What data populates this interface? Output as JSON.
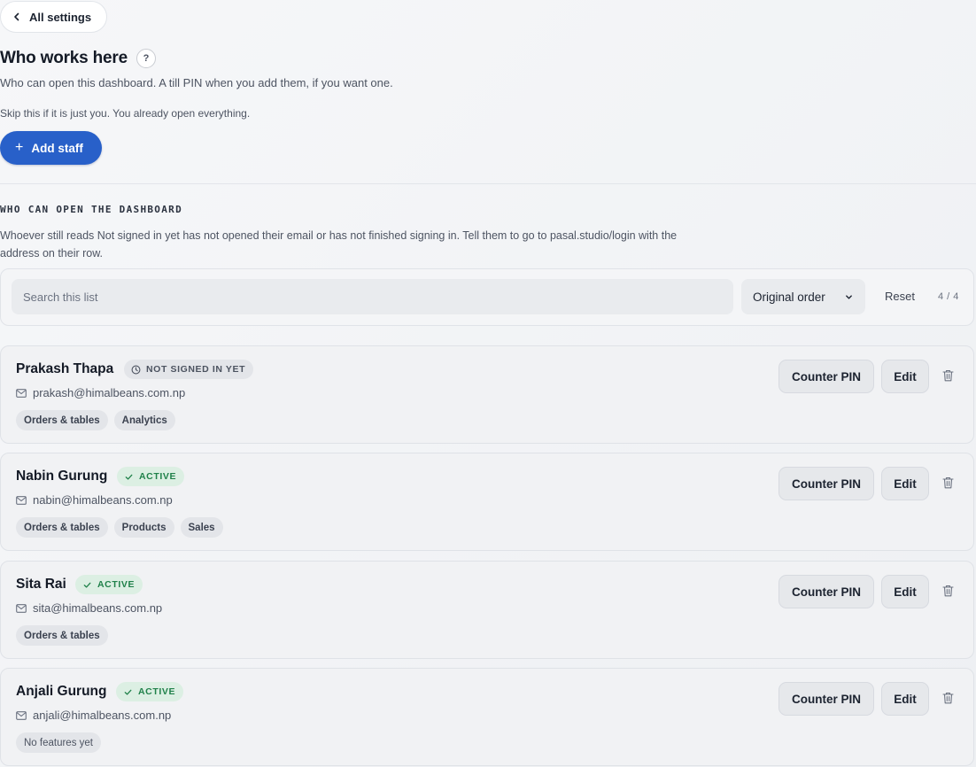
{
  "header": {
    "back_label": "All settings",
    "title": "Who works here",
    "help_glyph": "?",
    "subtitle": "Who can open this dashboard. A till PIN when you add them, if you want one.",
    "hint": "Skip this if it is just you. You already open everything.",
    "add_button_label": "Add staff"
  },
  "section": {
    "label": "WHO CAN OPEN THE DASHBOARD",
    "description": "Whoever still reads Not signed in yet has not opened their email or has not finished signing in. Tell them to go to pasal.studio/login with the address on their row."
  },
  "toolbar": {
    "search_placeholder": "Search this list",
    "sort_value": "Original order",
    "reset_label": "Reset",
    "count": "4 / 4"
  },
  "staff": [
    {
      "name": "Prakash Thapa",
      "status": "NOT SIGNED IN YET",
      "status_kind": "pending",
      "email": "prakash@himalbeans.com.np",
      "tags": [
        "Orders & tables",
        "Analytics"
      ],
      "pin_label": "Counter PIN",
      "edit_label": "Edit"
    },
    {
      "name": "Nabin Gurung",
      "status": "ACTIVE",
      "status_kind": "active",
      "email": "nabin@himalbeans.com.np",
      "tags": [
        "Orders & tables",
        "Products",
        "Sales"
      ],
      "pin_label": "Counter PIN",
      "edit_label": "Edit"
    },
    {
      "name": "Sita Rai",
      "status": "ACTIVE",
      "status_kind": "active",
      "email": "sita@himalbeans.com.np",
      "tags": [
        "Orders & tables"
      ],
      "pin_label": "Counter PIN",
      "edit_label": "Edit"
    },
    {
      "name": "Anjali Gurung",
      "status": "ACTIVE",
      "status_kind": "active",
      "email": "anjali@himalbeans.com.np",
      "tags": [
        "No features yet"
      ],
      "pin_label": "Counter PIN",
      "edit_label": "Edit"
    }
  ],
  "icons": {
    "back": "chevron-left-icon",
    "help": "help-icon",
    "add": "plus-icon",
    "sort": "chevron-down-icon",
    "pending": "clock-icon",
    "active": "check-icon",
    "email": "mail-icon",
    "delete": "trash-icon"
  },
  "colors": {
    "primary": "#2860c9",
    "active_bg": "#dcefe3",
    "active_text": "#20814a",
    "pending_bg": "#e3e5e9",
    "pending_text": "#4c5360"
  }
}
